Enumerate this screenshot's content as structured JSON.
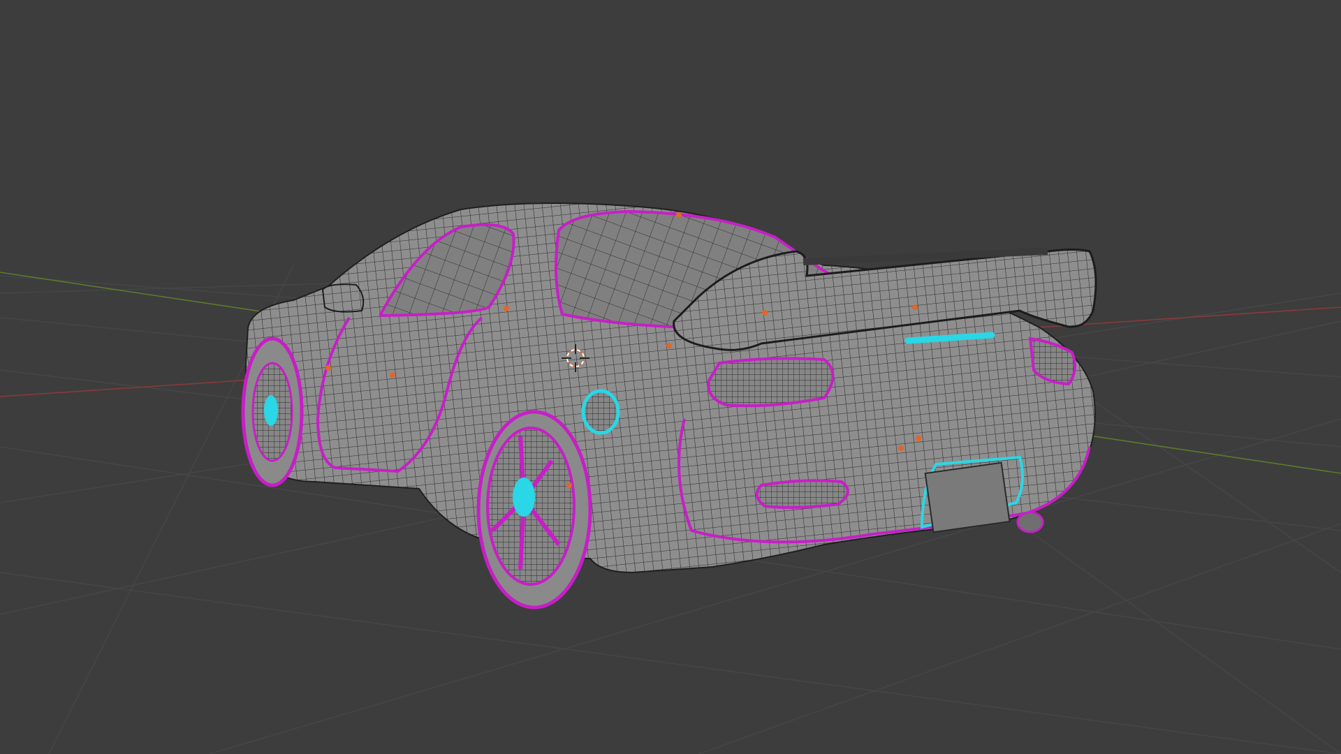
{
  "viewport": {
    "background": "#3d3d3d",
    "grid_color": "#4a4a4a",
    "x_axis_color": "#8a3a3a",
    "y_axis_color": "#5f7a2c"
  },
  "model": {
    "mesh_color": "#8f8f8f",
    "wire_color": "#2a2a2a",
    "seam_color": "#c81ec8",
    "selected_color": "#29d7e6",
    "vertex_color": "#e0672a"
  },
  "cursor_icon": "3d-cursor-icon"
}
